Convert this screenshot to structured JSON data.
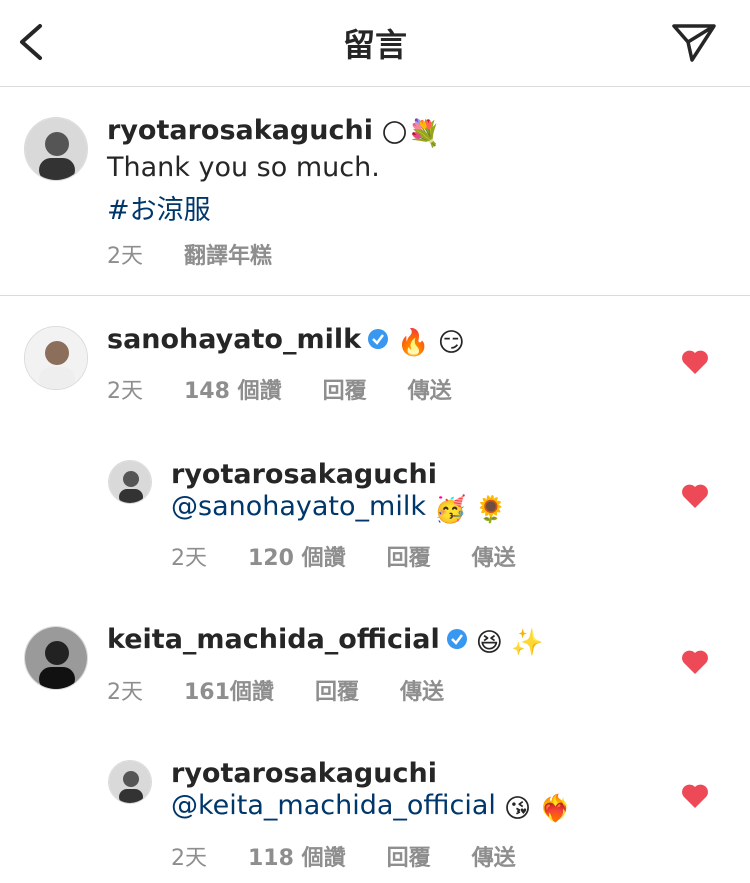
{
  "header": {
    "title": "留言"
  },
  "caption": {
    "username": "ryotarosakaguchi",
    "emojis": "🌕💐",
    "text": "Thank you so much.",
    "hashtag": "#お涼服",
    "time": "2天",
    "translate": "翻譯年糕"
  },
  "comments": [
    {
      "username": "sanohayato_milk",
      "verified": true,
      "emojis": "🔥 😏",
      "time": "2天",
      "likes": "148 個讚",
      "reply": "回覆",
      "share": "傳送"
    },
    {
      "username": "ryotarosakaguchi",
      "mention": "@sanohayato_milk",
      "emojis": "🥳 🌻",
      "time": "2天",
      "likes": "120 個讚",
      "reply": "回覆",
      "share": "傳送"
    },
    {
      "username": "keita_machida_official",
      "verified": true,
      "emojis": "😆 ✨",
      "time": "2天",
      "likes": "161個讚",
      "reply": "回覆",
      "share": "傳送"
    },
    {
      "username": "ryotarosakaguchi",
      "mention": "@keita_machida_official",
      "emojis": "😘 ❤️‍🔥",
      "time": "2天",
      "likes": "118 個讚",
      "reply": "回覆",
      "share": "傳送"
    }
  ],
  "colors": {
    "heart": "#ed4956",
    "verified": "#3897f0",
    "link": "#00376b",
    "meta": "#8e8e8e"
  }
}
